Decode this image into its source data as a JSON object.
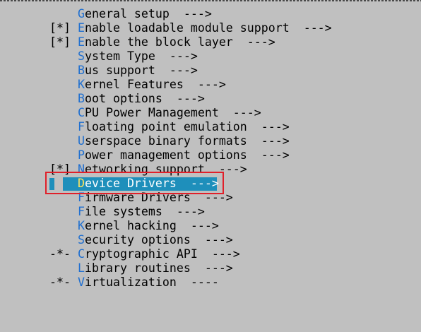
{
  "menu": {
    "items": [
      {
        "marker": "",
        "hotkey": "G",
        "rest": "eneral setup  --->",
        "selected": false
      },
      {
        "marker": "[*]",
        "hotkey": "E",
        "rest": "nable loadable module support  --->",
        "selected": false
      },
      {
        "marker": "[*]",
        "hotkey": "E",
        "rest": "nable the block layer  --->",
        "selected": false
      },
      {
        "marker": "",
        "hotkey": "S",
        "rest": "ystem Type  --->",
        "selected": false
      },
      {
        "marker": "",
        "hotkey": "B",
        "rest": "us support  --->",
        "selected": false
      },
      {
        "marker": "",
        "hotkey": "K",
        "rest": "ernel Features  --->",
        "selected": false
      },
      {
        "marker": "",
        "hotkey": "B",
        "rest": "oot options  --->",
        "selected": false
      },
      {
        "marker": "",
        "hotkey": "C",
        "rest": "PU Power Management  --->",
        "selected": false
      },
      {
        "marker": "",
        "hotkey": "F",
        "rest": "loating point emulation  --->",
        "selected": false
      },
      {
        "marker": "",
        "hotkey": "U",
        "rest": "serspace binary formats  --->",
        "selected": false
      },
      {
        "marker": "",
        "hotkey": "P",
        "rest": "ower management options  --->",
        "selected": false
      },
      {
        "marker": "[*]",
        "hotkey": "N",
        "rest": "etworking support  --->",
        "selected": false
      },
      {
        "marker": "",
        "hotkey": "D",
        "rest": "evice Drivers  --->",
        "selected": true
      },
      {
        "marker": "",
        "hotkey": "F",
        "rest": "irmware Drivers  --->",
        "selected": false
      },
      {
        "marker": "",
        "hotkey": "F",
        "rest": "ile systems  --->",
        "selected": false
      },
      {
        "marker": "",
        "hotkey": "K",
        "rest": "ernel hacking  --->",
        "selected": false
      },
      {
        "marker": "",
        "hotkey": "S",
        "rest": "ecurity options  --->",
        "selected": false
      },
      {
        "marker": "-*-",
        "hotkey": "C",
        "rest": "ryptographic API  --->",
        "selected": false
      },
      {
        "marker": "",
        "hotkey": "L",
        "rest": "ibrary routines  --->",
        "selected": false
      },
      {
        "marker": "-*-",
        "hotkey": "V",
        "rest": "irtualization  ----",
        "selected": false
      }
    ]
  },
  "colors": {
    "background": "#c0c0c0",
    "text": "#000000",
    "hotkey": "#1f6fd0",
    "selection_bar": "#1e8fbb",
    "selection_text": "#ffffff",
    "selection_hotkey": "#ffe45c",
    "annotation_box": "#e0202a"
  }
}
